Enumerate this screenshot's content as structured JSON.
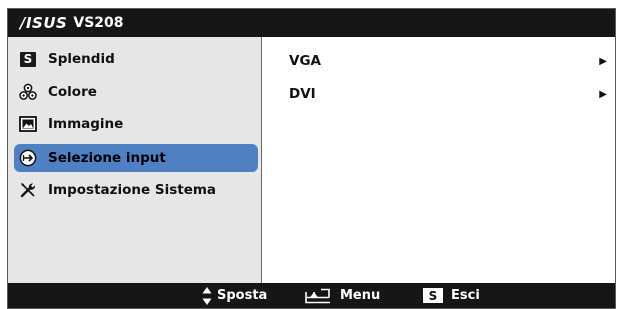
{
  "header": {
    "brand": "/ISUS",
    "model": "VS208"
  },
  "menu": {
    "items": [
      {
        "label": "Splendid",
        "icon": "splendid-s-icon",
        "selected": false
      },
      {
        "label": "Colore",
        "icon": "color-balls-icon",
        "selected": false
      },
      {
        "label": "Immagine",
        "icon": "image-icon",
        "selected": false
      },
      {
        "label": "Selezione input",
        "icon": "input-select-icon",
        "selected": true
      },
      {
        "label": "Impostazione Sistema",
        "icon": "tools-icon",
        "selected": false
      }
    ],
    "selected_color": "#4f80c4"
  },
  "submenu": {
    "items": [
      {
        "label": "VGA",
        "arrow": "▶"
      },
      {
        "label": "DVI",
        "arrow": "▶"
      }
    ]
  },
  "footer": {
    "move_label": "Sposta",
    "menu_label": "Menu",
    "exit_key": "S",
    "exit_label": "Esci"
  },
  "splendid_icon_letter": "S"
}
